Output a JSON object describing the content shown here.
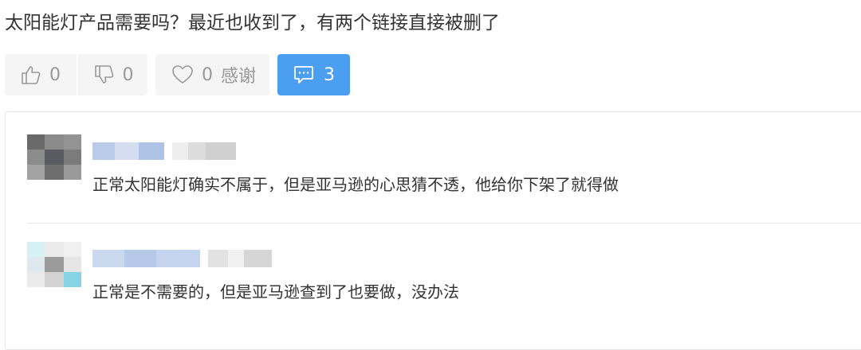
{
  "post": {
    "text": "太阳能灯产品需要吗？最近也收到了，有两个链接直接被删了"
  },
  "actions": {
    "like_count": "0",
    "dislike_count": "0",
    "thanks_count": "0",
    "thanks_label": "感谢",
    "comment_count": "3",
    "accent_color": "#4c9ef1"
  },
  "icons": {
    "like": "thumbs-up-icon",
    "dislike": "thumbs-down-icon",
    "thanks": "heart-icon",
    "comment": "comment-bubble-icon"
  },
  "comments": [
    {
      "text": "正常太阳能灯确实不属于，但是亚马逊的心思猜不透，他给你下架了就得做"
    },
    {
      "text": "正常是不需要的，但是亚马逊查到了也要做，没办法"
    }
  ]
}
